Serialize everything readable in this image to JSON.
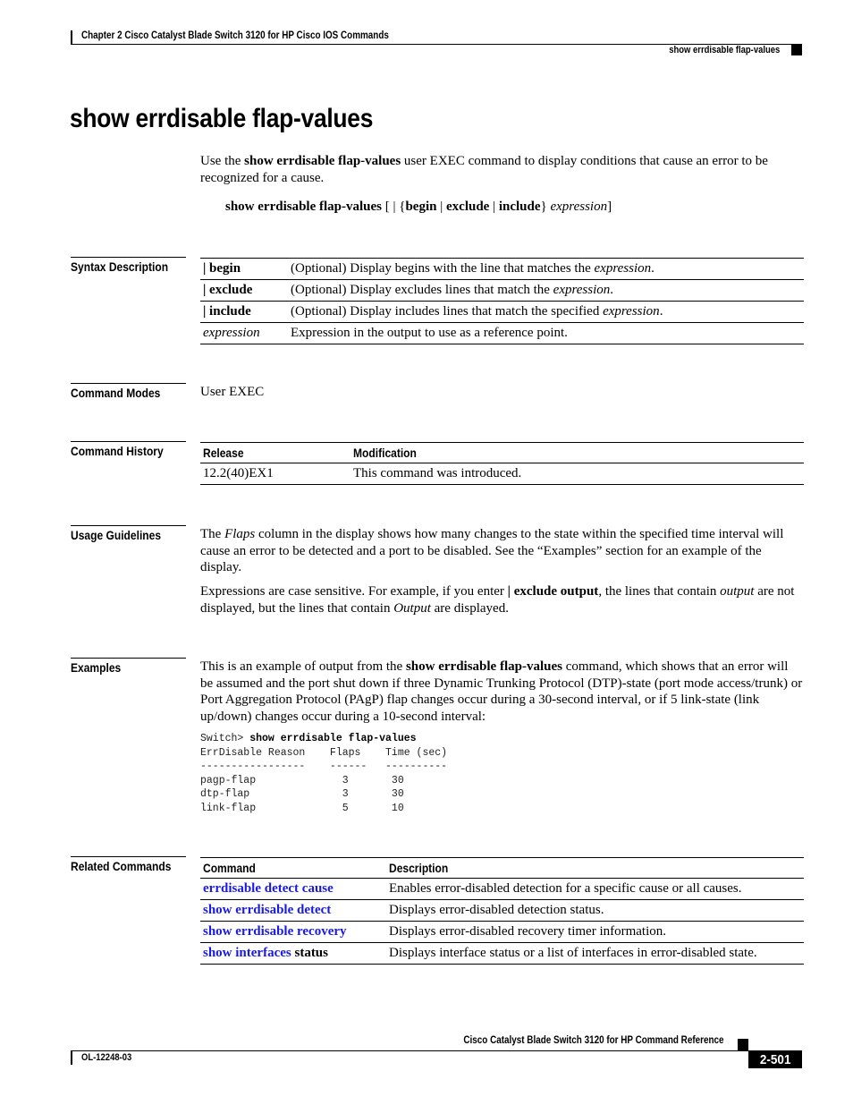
{
  "header": {
    "chapter": "Chapter  2 Cisco Catalyst Blade Switch 3120 for HP Cisco IOS Commands",
    "section": "show errdisable flap-values"
  },
  "title": "show errdisable flap-values",
  "intro": {
    "pre": "Use the ",
    "cmd": "show errdisable flap-values",
    "post": " user EXEC command to display conditions that cause an error to be recognized for a cause."
  },
  "syntax": {
    "cmd": "show errdisable flap-values",
    "open": " [ | {",
    "begin": "begin",
    "sep1": " | ",
    "exclude": "exclude",
    "sep2": " | ",
    "include": "include",
    "close_brace": "} ",
    "expression": "expression",
    "close": "]"
  },
  "syntax_description": {
    "label": "Syntax Description",
    "rows": [
      {
        "keyword": "| begin",
        "pre": "(Optional) Display begins with the line that matches the ",
        "em": "expression",
        "post": "."
      },
      {
        "keyword": "| exclude",
        "pre": "(Optional) Display excludes lines that match the ",
        "em": "expression",
        "post": "."
      },
      {
        "keyword": "| include",
        "pre": "(Optional) Display includes lines that match the specified ",
        "em": "expression",
        "post": "."
      },
      {
        "keyword_italic": "expression",
        "pre": "Expression in the output to use as a reference point.",
        "em": "",
        "post": ""
      }
    ]
  },
  "command_modes": {
    "label": "Command Modes",
    "value": "User EXEC"
  },
  "command_history": {
    "label": "Command History",
    "headers": [
      "Release",
      "Modification"
    ],
    "rows": [
      {
        "release": "12.2(40)EX1",
        "modification": "This command was introduced."
      }
    ]
  },
  "usage_guidelines": {
    "label": "Usage Guidelines",
    "p1": {
      "pre": "The ",
      "em": "Flaps",
      "post": " column in the display shows how many changes to the state within the specified time interval will cause an error to be detected and a port to be disabled. See the “Examples” section for an example of the display."
    },
    "p2": {
      "pre": "Expressions are case sensitive. For example, if you enter ",
      "bold": "| exclude output",
      "mid": ", the lines that contain ",
      "em1": "output",
      "mid2": " are not displayed, but the lines that contain ",
      "em2": "Output",
      "post": " are displayed."
    }
  },
  "examples": {
    "label": "Examples",
    "pre": "This is an example of output from the ",
    "cmd": "show errdisable flap-values",
    "post": " command, which shows that an error will be assumed and the port shut down if three Dynamic Trunking Protocol (DTP)-state (port mode access/trunk) or Port Aggregation Protocol (PAgP) flap changes occur during a 30-second interval, or if 5 link-state (link up/down) changes occur during a 10-second interval:",
    "prompt": "Switch> ",
    "command": "show errdisable flap-values",
    "output_lines": [
      "ErrDisable Reason    Flaps    Time (sec)",
      "-----------------    ------   ----------",
      "pagp-flap              3       30",
      "dtp-flap               3       30",
      "link-flap              5       10"
    ]
  },
  "related_commands": {
    "label": "Related Commands",
    "headers": [
      "Command",
      "Description"
    ],
    "rows": [
      {
        "link": "errdisable detect cause",
        "suffix": "",
        "description": "Enables error-disabled detection for a specific cause or all causes."
      },
      {
        "link": "show errdisable detect",
        "suffix": "",
        "description": "Displays error-disabled detection status."
      },
      {
        "link": "show errdisable recovery",
        "suffix": "",
        "description": "Displays error-disabled recovery timer information."
      },
      {
        "link": "show interfaces",
        "suffix": " status",
        "description": "Displays interface status or a list of interfaces in error-disabled state."
      }
    ]
  },
  "footer": {
    "title": "Cisco Catalyst Blade Switch 3120 for HP Command Reference",
    "doc_id": "OL-12248-03",
    "page": "2-501"
  },
  "colors": {
    "link": "#1a1ae6",
    "text": "#000000"
  }
}
